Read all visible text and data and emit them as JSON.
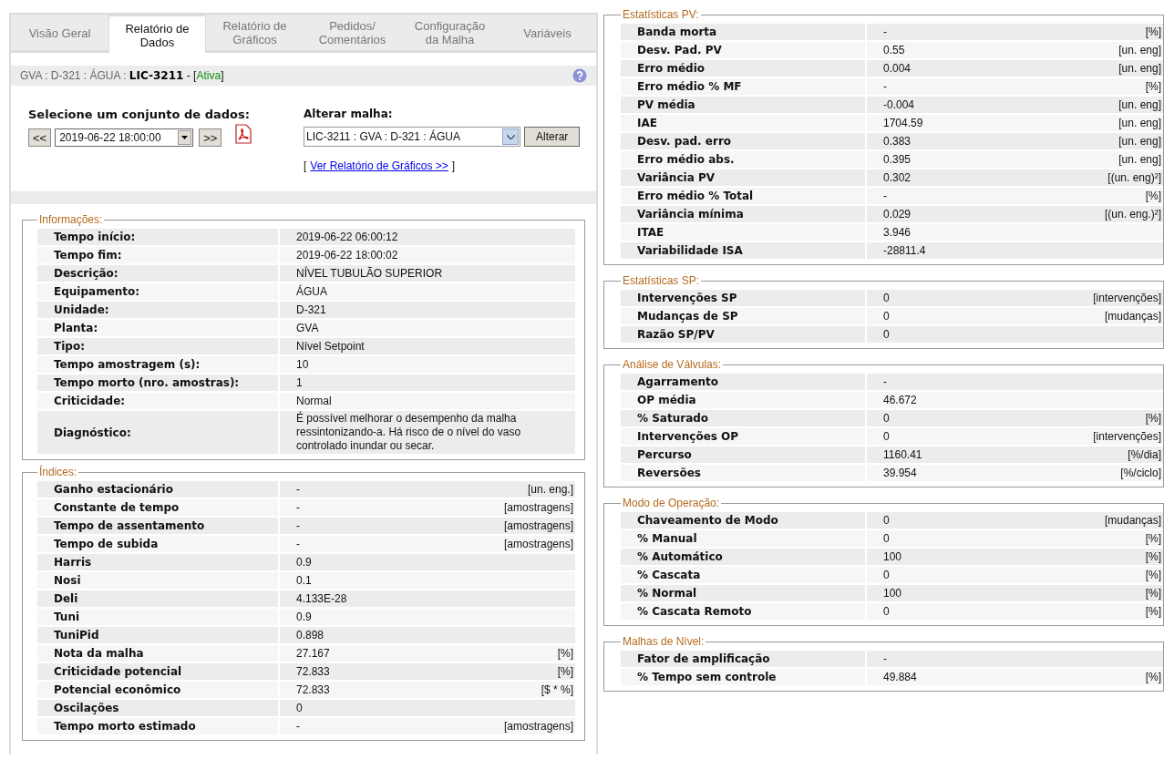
{
  "tabs": [
    {
      "label": "Visão Geral",
      "selected": false
    },
    {
      "label": "Relatório de Dados",
      "selected": true
    },
    {
      "label": "Relatório de Gráficos",
      "selected": false
    },
    {
      "label": "Pedidos/ Comentários",
      "selected": false
    },
    {
      "label": "Configuração da Malha",
      "selected": false
    },
    {
      "label": "Variáveis",
      "selected": false
    }
  ],
  "breadcrumb": {
    "path": "GVA : D-321 : ÁGUA :",
    "tag": "LIC-3211",
    "separator": "- [",
    "status": "Ativa",
    "closing": "]"
  },
  "dataset_selector": {
    "label": "Selecione um conjunto de dados:",
    "previous": "<<",
    "value": "2019-06-22 18:00:00",
    "next": ">>"
  },
  "loop_selector": {
    "label": "Alterar malha:",
    "value": "LIC-3211 : GVA : D-321 : ÁGUA",
    "button": "Alterar",
    "link_open": "[",
    "link": "Ver Relatório de Gráficos >>",
    "link_close": "]"
  },
  "left_sections": [
    {
      "title": "Informações:",
      "rows": [
        {
          "label": "Tempo início:",
          "value": "2019-06-22 06:00:12"
        },
        {
          "label": "Tempo fim:",
          "value": "2019-06-22 18:00:02"
        },
        {
          "label": "Descrição:",
          "value": "NÍVEL TUBULÃO SUPERIOR"
        },
        {
          "label": "Equipamento:",
          "value": "ÁGUA"
        },
        {
          "label": "Unidade:",
          "value": "D-321"
        },
        {
          "label": "Planta:",
          "value": "GVA"
        },
        {
          "label": "Tipo:",
          "value": "Nível Setpoint"
        },
        {
          "label": "Tempo amostragem (s):",
          "value": "10"
        },
        {
          "label": "Tempo morto (nro. amostras):",
          "value": "1"
        },
        {
          "label": "Criticidade:",
          "value": "Normal"
        },
        {
          "label": "Diagnóstico:",
          "value": "É possível melhorar o desempenho da malha ressintonizando-a. Há risco de o nível do vaso controlado inundar ou secar."
        }
      ]
    },
    {
      "title": "Índices:",
      "rows": [
        {
          "label": "Ganho estacionário",
          "value": "-",
          "unit": "[un. eng.]"
        },
        {
          "label": "Constante de tempo",
          "value": "-",
          "unit": "[amostragens]"
        },
        {
          "label": "Tempo de assentamento",
          "value": "-",
          "unit": "[amostragens]"
        },
        {
          "label": "Tempo de subida",
          "value": "-",
          "unit": "[amostragens]"
        },
        {
          "label": "Harris",
          "value": "0.9"
        },
        {
          "label": "Nosi",
          "value": "0.1"
        },
        {
          "label": "Deli",
          "value": "4.133E-28"
        },
        {
          "label": "Tuni",
          "value": "0.9"
        },
        {
          "label": "TuniPid",
          "value": "0.898"
        },
        {
          "label": "Nota da malha",
          "value": "27.167",
          "unit": "[%]"
        },
        {
          "label": "Criticidade potencial",
          "value": "72.833",
          "unit": "[%]"
        },
        {
          "label": "Potencial econômico",
          "value": "72.833",
          "unit": "[$ * %]"
        },
        {
          "label": "Oscilações",
          "value": "0"
        },
        {
          "label": "Tempo morto estimado",
          "value": "-",
          "unit": "[amostragens]"
        }
      ]
    }
  ],
  "right_sections": [
    {
      "title": "Estatísticas PV:",
      "rows": [
        {
          "label": "Banda morta",
          "value": "-",
          "unit": "[%]"
        },
        {
          "label": "Desv. Pad. PV",
          "value": "0.55",
          "unit": "[un. eng]"
        },
        {
          "label": "Erro médio",
          "value": "0.004",
          "unit": "[un. eng]"
        },
        {
          "label": "Erro médio % MF",
          "value": "-",
          "unit": "[%]"
        },
        {
          "label": "PV média",
          "value": "-0.004",
          "unit": "[un. eng]"
        },
        {
          "label": "IAE",
          "value": "1704.59",
          "unit": "[un. eng]"
        },
        {
          "label": "Desv. pad. erro",
          "value": "0.383",
          "unit": "[un. eng]"
        },
        {
          "label": "Erro médio abs.",
          "value": "0.395",
          "unit": "[un. eng]"
        },
        {
          "label": "Variância PV",
          "value": "0.302",
          "unit": "[(un. eng)²]"
        },
        {
          "label": "Erro médio % Total",
          "value": "-",
          "unit": "[%]"
        },
        {
          "label": "Variância mínima",
          "value": "0.029",
          "unit": "[(un. eng.)²]"
        },
        {
          "label": "ITAE",
          "value": "3.946"
        },
        {
          "label": "Variabilidade ISA",
          "value": "-28811.4"
        }
      ]
    },
    {
      "title": "Estatísticas SP:",
      "rows": [
        {
          "label": "Intervenções SP",
          "value": "0",
          "unit": "[intervenções]"
        },
        {
          "label": "Mudanças de SP",
          "value": "0",
          "unit": "[mudanças]"
        },
        {
          "label": "Razão SP/PV",
          "value": "0"
        }
      ]
    },
    {
      "title": "Análise de Válvulas:",
      "rows": [
        {
          "label": "Agarramento",
          "value": "-"
        },
        {
          "label": "OP média",
          "value": "46.672"
        },
        {
          "label": "% Saturado",
          "value": "0",
          "unit": "[%]"
        },
        {
          "label": "Intervenções OP",
          "value": "0",
          "unit": "[intervenções]"
        },
        {
          "label": "Percurso",
          "value": "1160.41",
          "unit": "[%/dia]"
        },
        {
          "label": "Reversões",
          "value": "39.954",
          "unit": "[%/ciclo]"
        }
      ]
    },
    {
      "title": "Modo de Operação:",
      "rows": [
        {
          "label": "Chaveamento de Modo",
          "value": "0",
          "unit": "[mudanças]"
        },
        {
          "label": "% Manual",
          "value": "0",
          "unit": "[%]"
        },
        {
          "label": "% Automático",
          "value": "100",
          "unit": "[%]"
        },
        {
          "label": "% Cascata",
          "value": "0",
          "unit": "[%]"
        },
        {
          "label": "% Normal",
          "value": "100",
          "unit": "[%]"
        },
        {
          "label": "% Cascata Remoto",
          "value": "0",
          "unit": "[%]"
        }
      ]
    },
    {
      "title": "Malhas de Nível:",
      "rows": [
        {
          "label": "Fator de amplificação",
          "value": "-"
        },
        {
          "label": "% Tempo sem controle",
          "value": "49.884",
          "unit": "[%]"
        }
      ]
    }
  ]
}
